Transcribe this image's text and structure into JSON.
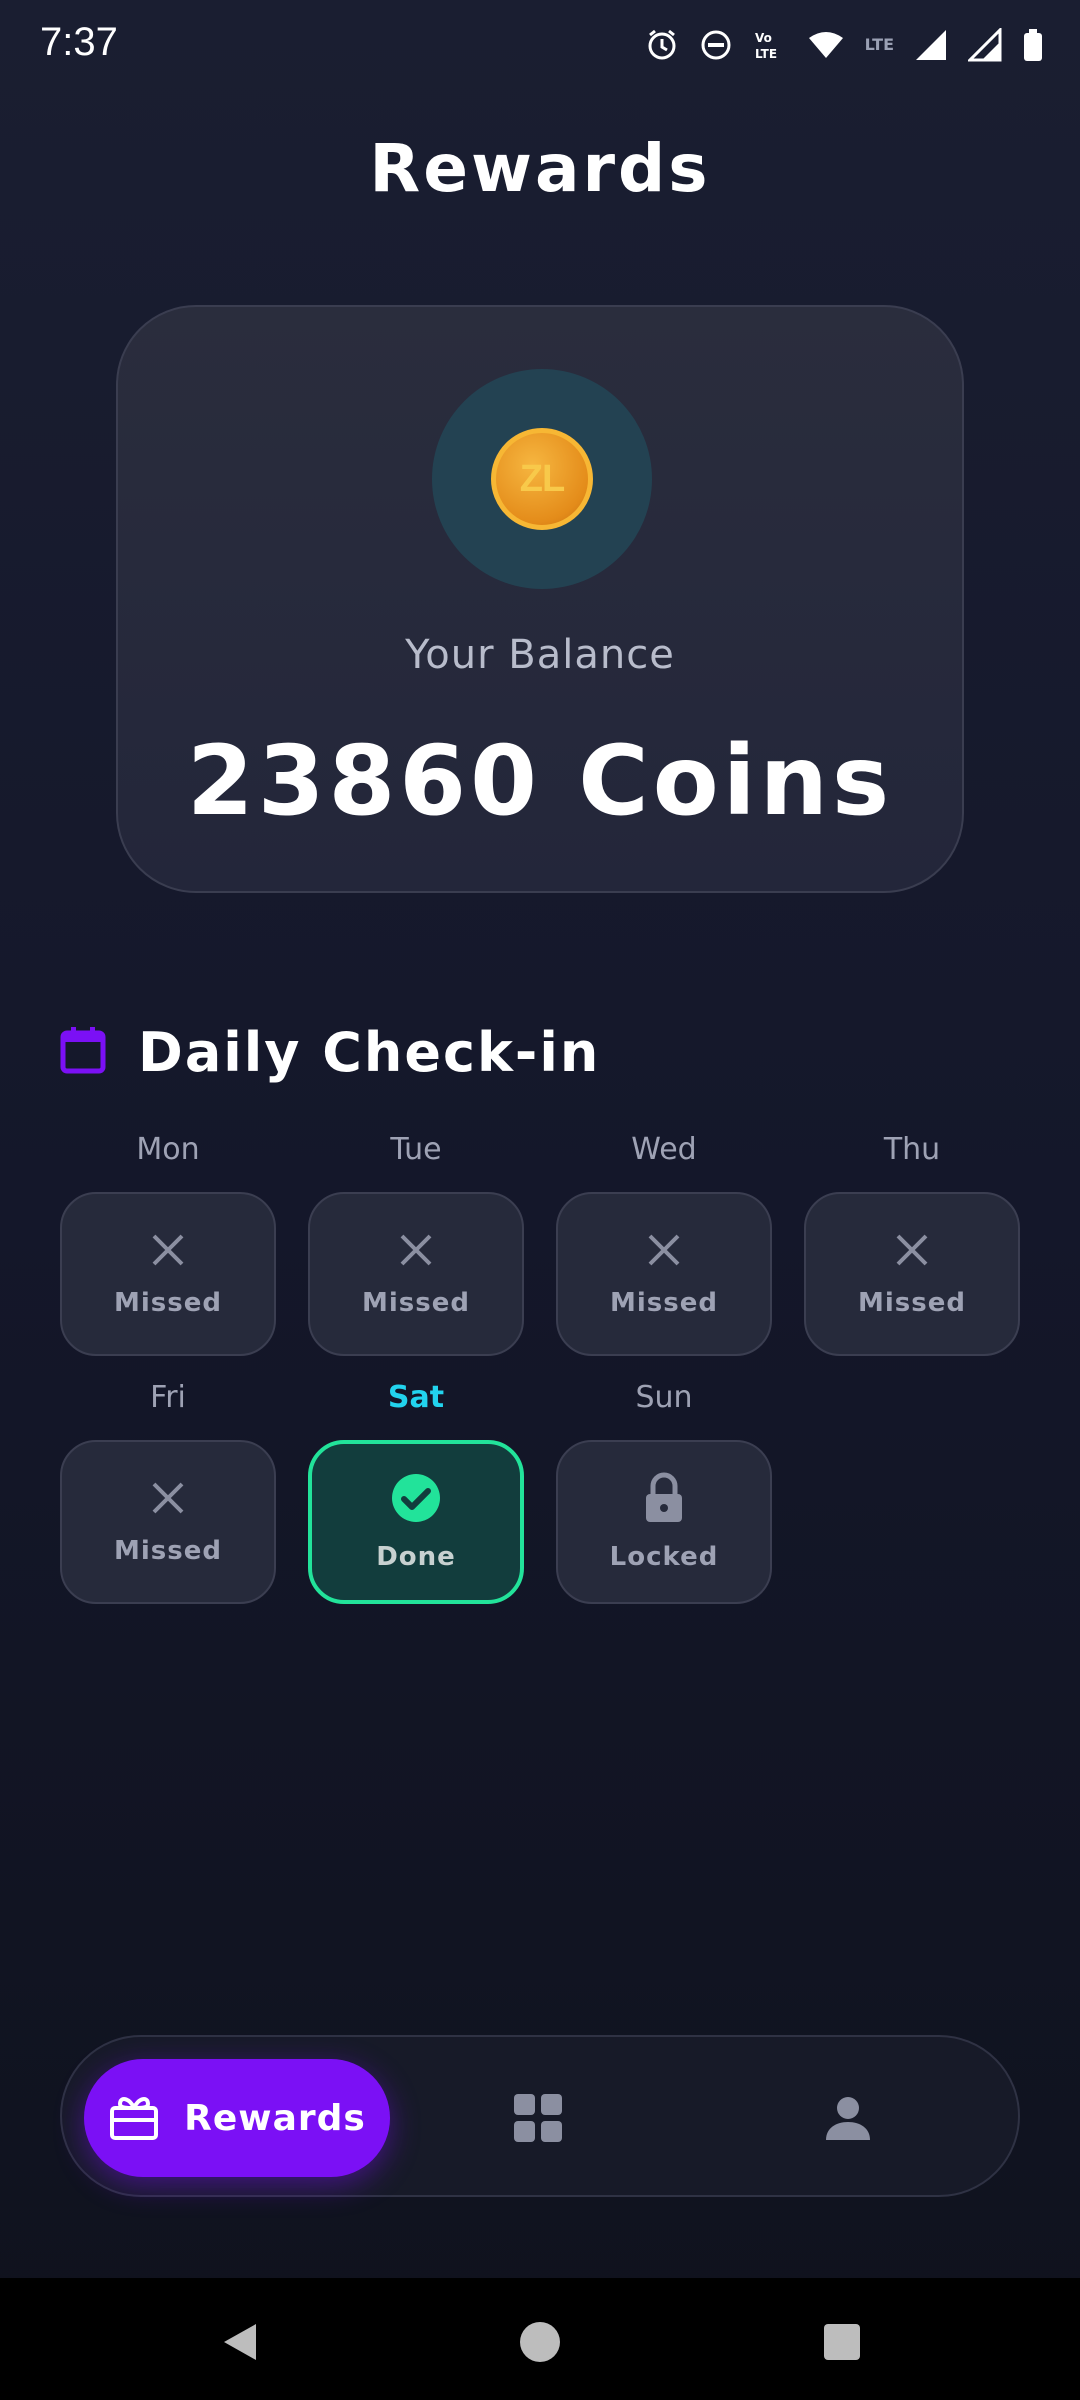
{
  "status_bar": {
    "time": "7:37",
    "lte_label": "LTE",
    "icons": [
      "alarm-icon",
      "dnd-icon",
      "volte-icon",
      "wifi-icon",
      "signal-icon",
      "signal-icon",
      "battery-icon"
    ]
  },
  "header": {
    "title": "Rewards"
  },
  "balance": {
    "coin_text": "ZL",
    "label": "Your Balance",
    "value": "23860 Coins"
  },
  "checkin": {
    "title": "Daily Check-in",
    "icon": "calendar-icon",
    "days": [
      {
        "name": "Mon",
        "status": "Missed",
        "icon": "close-icon"
      },
      {
        "name": "Tue",
        "status": "Missed",
        "icon": "close-icon"
      },
      {
        "name": "Wed",
        "status": "Missed",
        "icon": "close-icon"
      },
      {
        "name": "Thu",
        "status": "Missed",
        "icon": "close-icon"
      },
      {
        "name": "Fri",
        "status": "Missed",
        "icon": "close-icon"
      },
      {
        "name": "Sat",
        "status": "Done",
        "icon": "check-circle-icon",
        "active": true
      },
      {
        "name": "Sun",
        "status": "Locked",
        "icon": "lock-icon"
      }
    ]
  },
  "bottom_nav": {
    "rewards_label": "Rewards",
    "items": [
      "gift-icon",
      "grid-icon",
      "person-icon"
    ]
  },
  "colors": {
    "accent": "#7b10f5",
    "done": "#22e39a",
    "active_day": "#22d3ee",
    "coin": "#f7b734"
  }
}
